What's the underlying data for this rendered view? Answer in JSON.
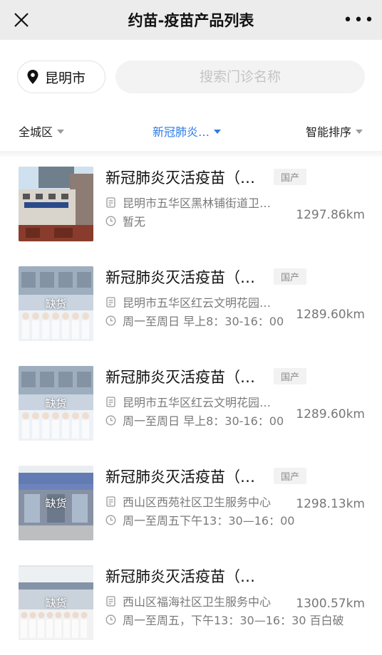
{
  "header": {
    "title": "约苗-疫苗产品列表",
    "close_icon": "close-icon",
    "more_icon": "more-dots-icon",
    "more_label": "•••"
  },
  "location": {
    "city": "昆明市"
  },
  "search": {
    "placeholder": "搜索门诊名称",
    "value": ""
  },
  "filters": [
    {
      "label": "全城区",
      "active": false
    },
    {
      "label": "新冠肺炎…",
      "active": true
    },
    {
      "label": "智能排序",
      "active": false
    }
  ],
  "colors": {
    "accent": "#2e7be6",
    "title_bar": "#ececec"
  },
  "items": [
    {
      "name": "新冠肺炎灭活疫苗（…",
      "tag": "国产",
      "address": "昆明市五华区黑林铺街道卫…",
      "hours": "暂无",
      "distance": "1297.86km",
      "status": ""
    },
    {
      "name": "新冠肺炎灭活疫苗（…",
      "tag": "国产",
      "address": "昆明市五华区红云文明花园…",
      "hours": "周一至周日 早上8：30-16：00",
      "distance": "1289.60km",
      "status": "缺货"
    },
    {
      "name": "新冠肺炎灭活疫苗（…",
      "tag": "国产",
      "address": "昆明市五华区红云文明花园…",
      "hours": "周一至周日 早上8：30-16：00",
      "distance": "1289.60km",
      "status": "缺货"
    },
    {
      "name": "新冠肺炎灭活疫苗（…",
      "tag": "国产",
      "address": "西山区西苑社区卫生服务中心",
      "hours": "周一至周五下午13：30—16：00",
      "distance": "1298.13km",
      "status": "缺货"
    },
    {
      "name": "新冠肺炎灭活疫苗（…",
      "tag": "",
      "address": "西山区福海社区卫生服务中心",
      "hours": "周一至周五，下午13：30—16：30 百白破",
      "distance": "1300.57km",
      "status": "缺货"
    }
  ]
}
